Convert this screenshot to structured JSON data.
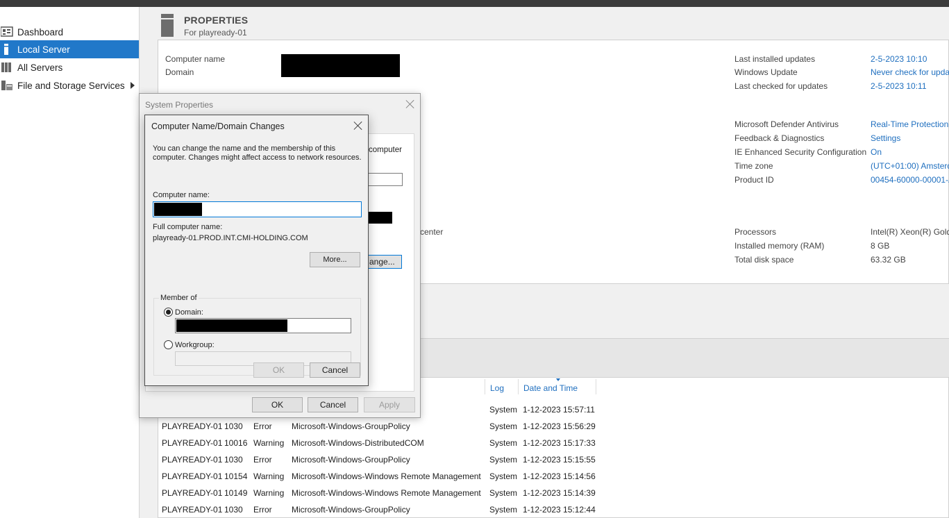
{
  "sidebar": {
    "items": [
      {
        "label": "Dashboard",
        "icon": "dashboard-icon"
      },
      {
        "label": "Local Server",
        "icon": "server-icon",
        "active": true
      },
      {
        "label": "All Servers",
        "icon": "servers-icon"
      },
      {
        "label": "File and Storage Services",
        "icon": "storage-icon"
      }
    ]
  },
  "properties": {
    "title": "PROPERTIES",
    "subtitle": "For playready-01",
    "left": [
      {
        "label": "Computer name"
      },
      {
        "label": "Domain"
      }
    ],
    "right_top": [
      {
        "label": "Last installed updates",
        "value": "2-5-2023 10:10"
      },
      {
        "label": "Windows Update",
        "value": "Never check for upda"
      },
      {
        "label": "Last checked for updates",
        "value": "2-5-2023 10:11"
      }
    ],
    "right_mid": [
      {
        "label": "Microsoft Defender Antivirus",
        "value": "Real-Time Protection:"
      },
      {
        "label": "Feedback & Diagnostics",
        "value": "Settings"
      },
      {
        "label": "IE Enhanced Security Configuration",
        "value": "On"
      },
      {
        "label": "Time zone",
        "value": "(UTC+01:00) Amsterd"
      },
      {
        "label": "Product ID",
        "value": "00454-60000-00001-A"
      }
    ],
    "right_bottom": [
      {
        "label": "Processors",
        "value": "Intel(R) Xeon(R) Gold"
      },
      {
        "label": "Installed memory (RAM)",
        "value": "8 GB"
      },
      {
        "label": "Total disk space",
        "value": "63.32 GB"
      }
    ],
    "partial_center": "center"
  },
  "events": {
    "columns": {
      "log": "Log",
      "date": "Date and Time"
    },
    "rows": [
      {
        "server": "",
        "id": "",
        "severity": "",
        "source": "",
        "log": "System",
        "date": "1-12-2023 15:57:11"
      },
      {
        "server": "PLAYREADY-01",
        "id": "1030",
        "severity": "Error",
        "source": "Microsoft-Windows-GroupPolicy",
        "log": "System",
        "date": "1-12-2023 15:56:29"
      },
      {
        "server": "PLAYREADY-01",
        "id": "10016",
        "severity": "Warning",
        "source": "Microsoft-Windows-DistributedCOM",
        "log": "System",
        "date": "1-12-2023 15:17:33"
      },
      {
        "server": "PLAYREADY-01",
        "id": "1030",
        "severity": "Error",
        "source": "Microsoft-Windows-GroupPolicy",
        "log": "System",
        "date": "1-12-2023 15:15:55"
      },
      {
        "server": "PLAYREADY-01",
        "id": "10154",
        "severity": "Warning",
        "source": "Microsoft-Windows-Windows Remote Management",
        "log": "System",
        "date": "1-12-2023 15:14:56"
      },
      {
        "server": "PLAYREADY-01",
        "id": "10149",
        "severity": "Warning",
        "source": "Microsoft-Windows-Windows Remote Management",
        "log": "System",
        "date": "1-12-2023 15:14:39"
      },
      {
        "server": "PLAYREADY-01",
        "id": "1030",
        "severity": "Error",
        "source": "Microsoft-Windows-GroupPolicy",
        "log": "System",
        "date": "1-12-2023 15:12:44"
      }
    ]
  },
  "system_properties": {
    "title": "System Properties",
    "partial_text": "computer",
    "change_button_partial": "ange...",
    "ok": "OK",
    "cancel": "Cancel",
    "apply": "Apply"
  },
  "computer_name_dialog": {
    "title": "Computer Name/Domain Changes",
    "description_line1": "You can change the name and the membership of this",
    "description_line2": "computer. Changes might affect access to network resources.",
    "computer_name_label": "Computer name:",
    "full_name_label": "Full computer name:",
    "full_name_value": "playready-01.PROD.INT.CMI-HOLDING.COM",
    "more_button": "More...",
    "member_of_label": "Member of",
    "domain_label": "Domain:",
    "workgroup_label": "Workgroup:",
    "ok": "OK",
    "cancel": "Cancel",
    "selected_membership": "Domain"
  },
  "colors": {
    "accent": "#2178c9",
    "link": "#1f6fbf"
  }
}
